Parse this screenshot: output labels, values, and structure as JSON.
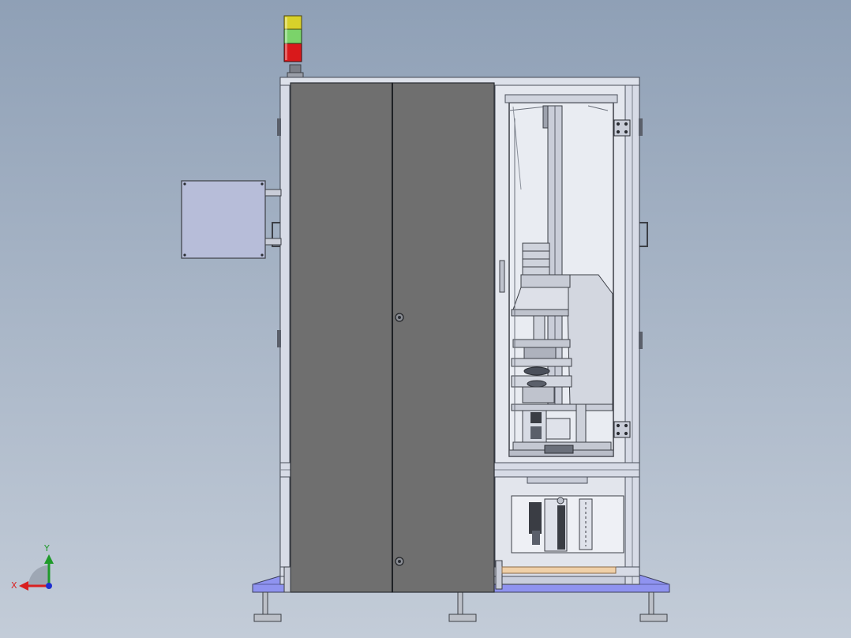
{
  "triad": {
    "x_label": "X",
    "y_label": "Y"
  },
  "colors": {
    "background_top": "#8fa0b6",
    "background_bottom": "#c3ccd8",
    "frame": "#c9cedd",
    "frame_edge": "#4a4f5a",
    "door": "#6f6f6f",
    "base_plate": "#8f93f0",
    "control_box": "#b7bdd9",
    "light_green": "#7bd36a",
    "light_yellow": "#d8d12a",
    "light_red": "#d9191b",
    "axis_x": "#d92020",
    "axis_y": "#1f9a2a",
    "axis_z": "#1f2fd0",
    "wood_strip": "#f0d0a8"
  },
  "icons": [
    "stack-light-icon",
    "door-lock-icon",
    "hinge-icon",
    "handle-icon",
    "axis-triad-icon"
  ]
}
